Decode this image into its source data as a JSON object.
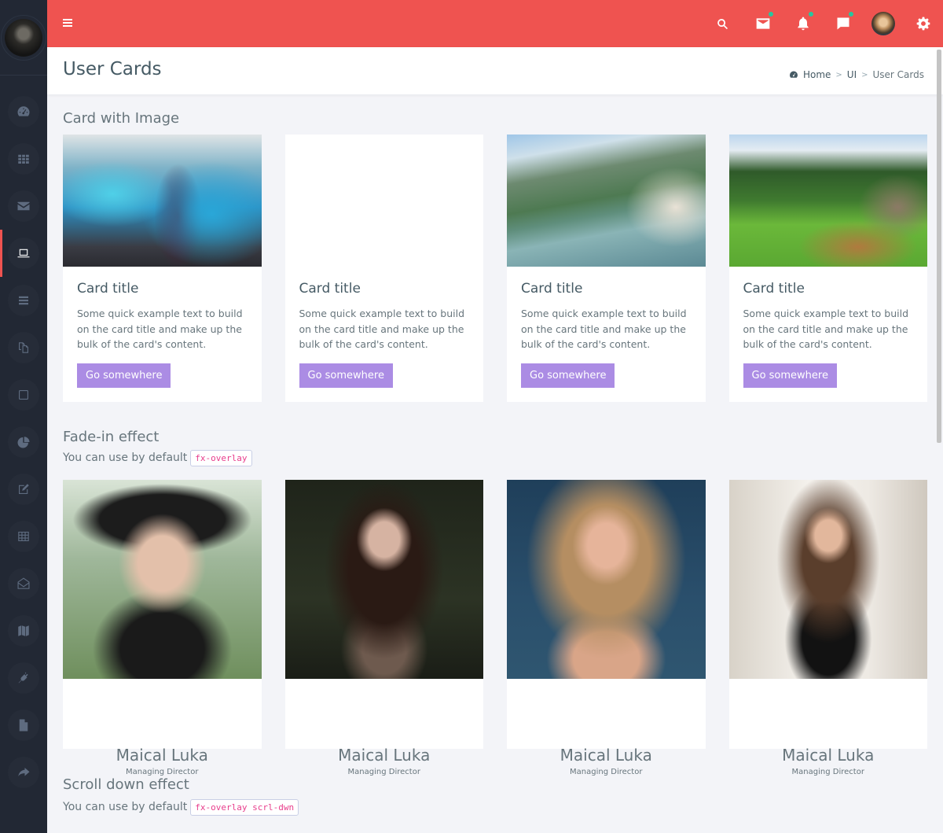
{
  "topbar": {
    "icons": [
      "search-icon",
      "mail-icon",
      "bell-icon",
      "chat-icon",
      "user-avatar",
      "gear-icon"
    ],
    "accent": "#ef5350",
    "notification_dot_color": "#26c6a0"
  },
  "sidebar": {
    "items": [
      {
        "icon": "dashboard-icon",
        "active": false
      },
      {
        "icon": "apps-grid-icon",
        "active": false
      },
      {
        "icon": "envelope-icon",
        "active": false
      },
      {
        "icon": "laptop-icon",
        "active": true
      },
      {
        "icon": "list-icon",
        "active": false
      },
      {
        "icon": "copy-icon",
        "active": false
      },
      {
        "icon": "square-icon",
        "active": false
      },
      {
        "icon": "pie-chart-icon",
        "active": false
      },
      {
        "icon": "edit-icon",
        "active": false
      },
      {
        "icon": "table-icon",
        "active": false
      },
      {
        "icon": "envelope-open-icon",
        "active": false
      },
      {
        "icon": "map-icon",
        "active": false
      },
      {
        "icon": "plug-icon",
        "active": false
      },
      {
        "icon": "file-icon",
        "active": false
      },
      {
        "icon": "share-icon",
        "active": false
      }
    ]
  },
  "header": {
    "title": "User Cards",
    "breadcrumb": [
      "Home",
      "UI",
      "User Cards"
    ]
  },
  "section1": {
    "title": "Card with Image",
    "cards": [
      {
        "title": "Card title",
        "text": "Some quick example text to build on the card title and make up the bulk of the card's content.",
        "button": "Go somewhere"
      },
      {
        "title": "Card title",
        "text": "Some quick example text to build on the card title and make up the bulk of the card's content.",
        "button": "Go somewhere"
      },
      {
        "title": "Card title",
        "text": "Some quick example text to build on the card title and make up the bulk of the card's content.",
        "button": "Go somewhere"
      },
      {
        "title": "Card title",
        "text": "Some quick example text to build on the card title and make up the bulk of the card's content.",
        "button": "Go somewhere"
      }
    ]
  },
  "section2": {
    "title": "Fade-in effect",
    "subtitle": "You can use by default",
    "code": "fx-overlay",
    "people": [
      {
        "name": "Maical Luka",
        "role": "Managing Director"
      },
      {
        "name": "Maical Luka",
        "role": "Managing Director"
      },
      {
        "name": "Maical Luka",
        "role": "Managing Director"
      },
      {
        "name": "Maical Luka",
        "role": "Managing Director"
      }
    ]
  },
  "section3": {
    "title": "Scroll down effect",
    "subtitle": "You can use by default",
    "code": "fx-overlay scrl-dwn"
  }
}
